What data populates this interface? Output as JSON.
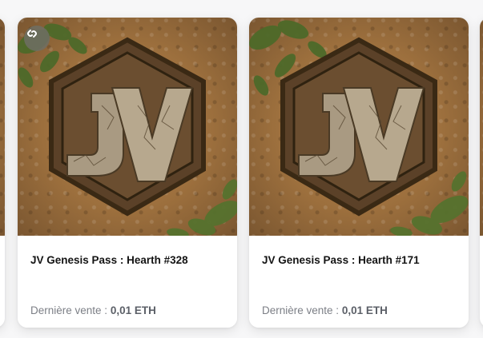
{
  "cards": [
    {
      "name": "JV Genesis Pass : Hearth #328",
      "last_sale_label": "Dernière vente :",
      "last_sale_value": "0,01 ETH",
      "image_icon": "jv-logo-stone-hexagon",
      "badge_icon": "infinity-icon"
    },
    {
      "name": "JV Genesis Pass : Hearth #171",
      "last_sale_label": "Dernière vente :",
      "last_sale_value": "0,01 ETH",
      "image_icon": "jv-logo-stone-hexagon"
    }
  ],
  "colors": {
    "accent_text": "#5c6068",
    "muted_text": "#7c7f86",
    "title_text": "#141414",
    "art_sand": "#a87a45"
  }
}
